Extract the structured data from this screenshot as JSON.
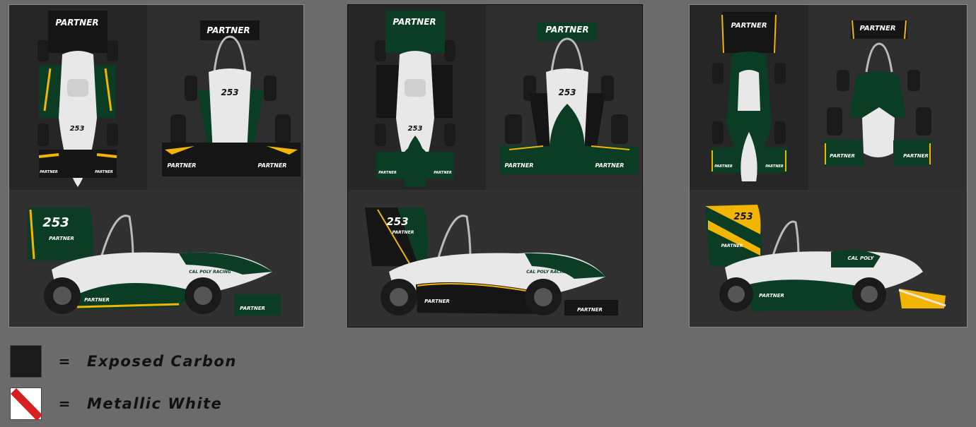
{
  "liveries": [
    {
      "id": "1",
      "number": "253",
      "sponsor": "PARTNER",
      "side_text": "CAL POLY RACING",
      "colors": {
        "body": "#e8e8e8",
        "accent": "#0b3d24",
        "stripe": "#f2b500"
      }
    },
    {
      "id": "2",
      "number": "253",
      "sponsor": "PARTNER",
      "side_text": "CAL POLY RACING",
      "colors": {
        "body": "#e8e8e8",
        "accent": "#0b3d24",
        "stripe": "#f2b500"
      }
    },
    {
      "id": "3",
      "number": "253",
      "sponsor": "PARTNER",
      "side_text": "CAL POLY",
      "colors": {
        "body": "#e8e8e8",
        "accent": "#0b3d24",
        "stripe": "#f2b500"
      }
    }
  ],
  "legend": [
    {
      "swatch": "carbon",
      "equals": "=",
      "label": "Exposed Carbon",
      "color": "#1a1a1a"
    },
    {
      "swatch": "metallic-white",
      "equals": "=",
      "label": "Metallic White",
      "color": "#ffffff",
      "stripe_color": "#d62020"
    }
  ]
}
